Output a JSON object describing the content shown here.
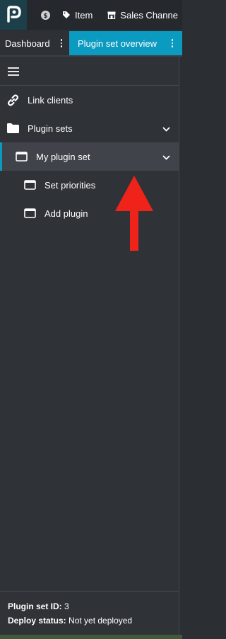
{
  "header": {
    "logo_icon": "plenty-logo-icon",
    "items": [
      {
        "icon": "dollar-circle-icon",
        "label": ""
      },
      {
        "icon": "tag-icon",
        "label": "Item"
      },
      {
        "icon": "storefront-icon",
        "label": "Sales Channe"
      }
    ]
  },
  "tabs": [
    {
      "label": "Dashboard",
      "active": false
    },
    {
      "label": "Plugin set overview",
      "active": true
    }
  ],
  "sidebar": {
    "menu_icon": "hamburger-menu-icon",
    "items": [
      {
        "label": "Link clients",
        "icon": "link-icon",
        "chevron": false,
        "selected": false
      },
      {
        "label": "Plugin sets",
        "icon": "folder-icon",
        "chevron": true,
        "selected": false
      },
      {
        "label": "My plugin set",
        "icon": "window-icon",
        "chevron": true,
        "selected": true
      },
      {
        "label": "Set priorities",
        "icon": "window-icon",
        "chevron": false,
        "selected": false
      },
      {
        "label": "Add plugin",
        "icon": "window-icon",
        "chevron": false,
        "selected": false
      }
    ],
    "footer": {
      "id_label": "Plugin set ID:",
      "id_value": "3",
      "status_label": "Deploy status:",
      "status_value": "Not yet deployed"
    }
  },
  "annotation": {
    "icon": "red-arrow-up-icon",
    "color": "#f0231b"
  },
  "colors": {
    "accent": "#0c9bc0",
    "sidebar_bg": "#2f3237",
    "header_bg": "#25282d"
  }
}
